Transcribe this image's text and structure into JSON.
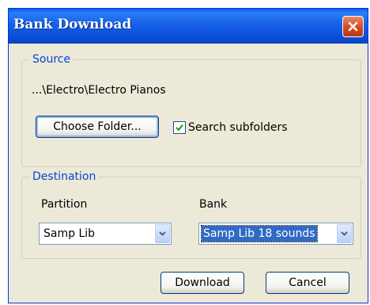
{
  "window": {
    "title": "Bank Download",
    "close_icon": "close-icon"
  },
  "source": {
    "legend": "Source",
    "path": "...\\Electro\\Electro Pianos",
    "choose_folder_label": "Choose Folder...",
    "search_subfolders_label": "Search subfolders",
    "search_subfolders_checked": true
  },
  "destination": {
    "legend": "Destination",
    "partition_label": "Partition",
    "partition_value": "Samp Lib",
    "bank_label": "Bank",
    "bank_value": "Samp Lib 18 sounds"
  },
  "buttons": {
    "download_label": "Download",
    "cancel_label": "Cancel"
  },
  "colors": {
    "title_bar": "#0a5fe8",
    "close_button": "#d24a22",
    "group_legend": "#0046d5",
    "selection": "#316ac5"
  }
}
